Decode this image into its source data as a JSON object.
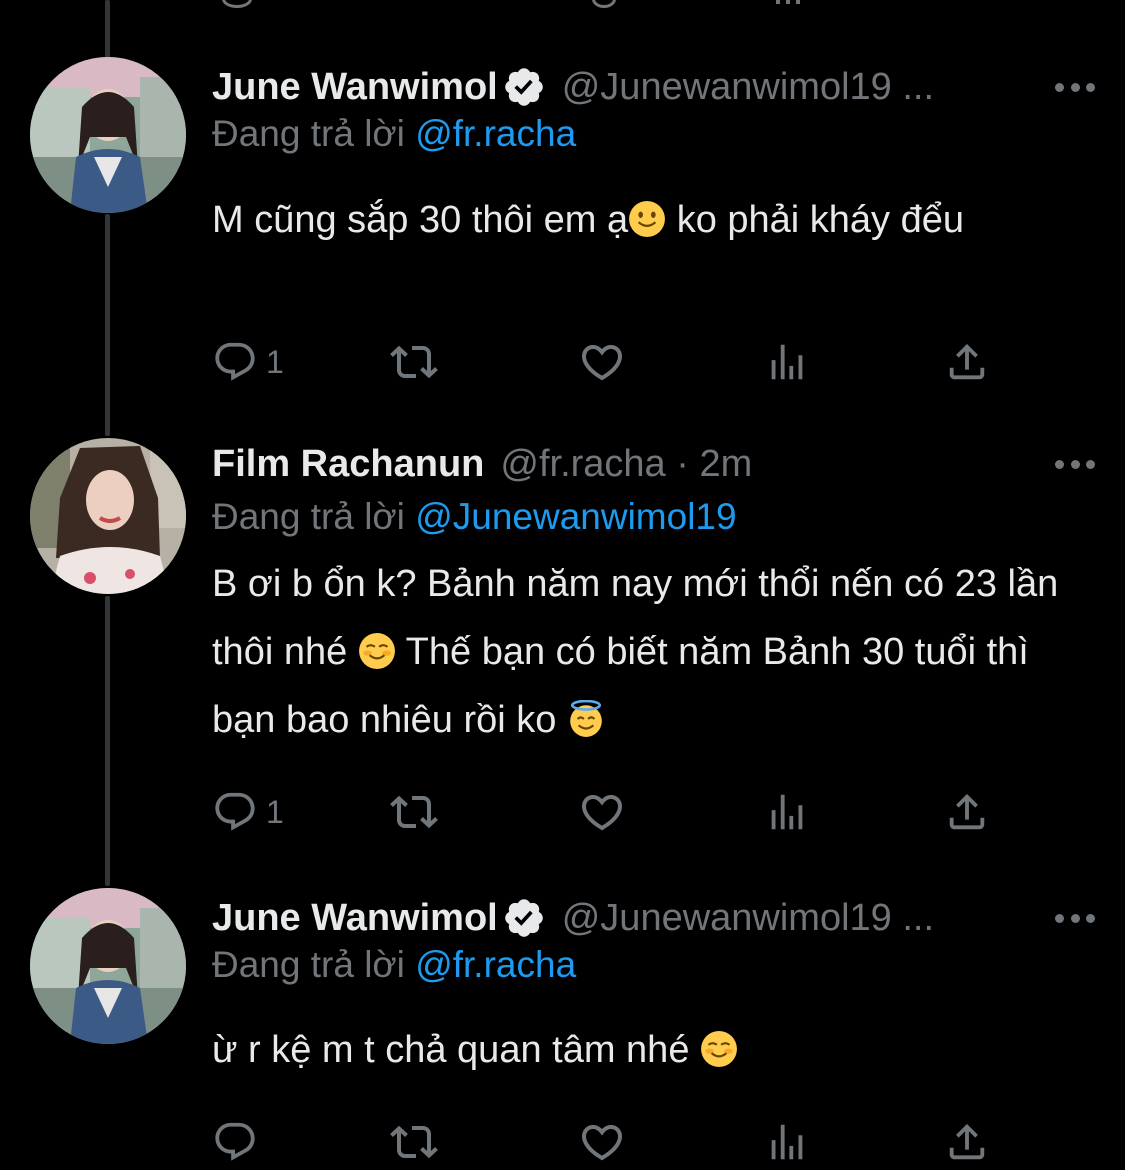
{
  "tweets": [
    {
      "name": "June Wanwimol",
      "verified": true,
      "handle": "@Junewanwimol19 ...",
      "reply_prefix": "Đang trả lời",
      "reply_to": "@fr.racha",
      "text_parts": [
        "M cũng sắp 30 thôi em ạ",
        " ko phải kháy đểu"
      ],
      "emojis": [
        "slightly-smiling-face"
      ],
      "reply_count": "1",
      "retweet_count": "",
      "like_count": ""
    },
    {
      "name": "Film Rachanun",
      "verified": false,
      "handle": "@fr.racha · 2m",
      "reply_prefix": "Đang trả lời",
      "reply_to": "@Junewanwimol19",
      "text_parts": [
        "B ơi b ổn k? Bảnh năm nay mới thổi nến có 23 lần thôi nhé ",
        "  Thế bạn có biết năm Bảnh 30 tuổi thì bạn bao nhiêu rồi ko "
      ],
      "emojis": [
        "smiling-face",
        "smiling-face-with-halo"
      ],
      "reply_count": "1",
      "retweet_count": "",
      "like_count": ""
    },
    {
      "name": "June Wanwimol",
      "verified": true,
      "handle": "@Junewanwimol19 ...",
      "reply_prefix": "Đang trả lời",
      "reply_to": "@fr.racha",
      "text_parts": [
        "ừ r kệ m t chả quan tâm nhé "
      ],
      "emojis": [
        "smiling-face"
      ],
      "reply_count": "",
      "retweet_count": "",
      "like_count": ""
    }
  ],
  "icons": {
    "reply": "reply-icon",
    "retweet": "retweet-icon",
    "like": "heart-icon",
    "views": "views-icon",
    "share": "share-icon",
    "more": "more-icon",
    "verified": "verified-badge-icon"
  },
  "colors": {
    "background": "#000000",
    "text": "#e7e9ea",
    "muted": "#71767b",
    "link": "#1d9bf0",
    "thread_line": "#333639"
  }
}
